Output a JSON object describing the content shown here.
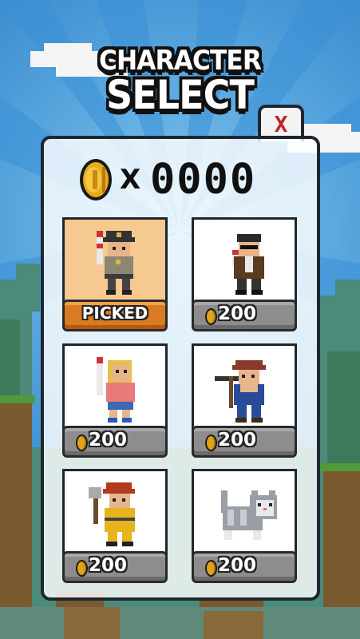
{
  "title": {
    "line1": "CHARACTER",
    "line2": "SELECT"
  },
  "close_button": {
    "label": "X"
  },
  "coins": {
    "multiplier": "X",
    "count": "0000"
  },
  "characters": [
    {
      "id": "sheriff",
      "status": "PICKED"
    },
    {
      "id": "bandit",
      "price": "200"
    },
    {
      "id": "girl",
      "price": "200"
    },
    {
      "id": "farmer",
      "price": "200"
    },
    {
      "id": "firefighter",
      "price": "200"
    },
    {
      "id": "cat",
      "price": "200"
    }
  ],
  "colors": {
    "sky": "#2a86d0",
    "panel_border": "#1e2630",
    "picked": "#d97b22",
    "coin": "#e0a41a"
  }
}
